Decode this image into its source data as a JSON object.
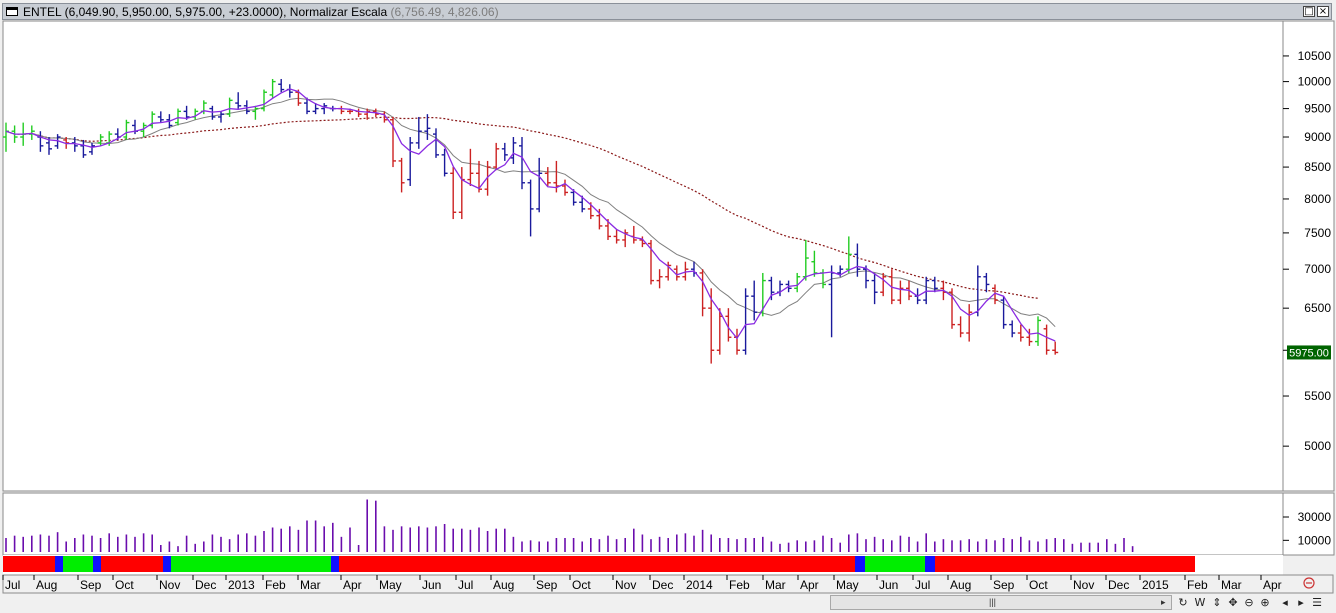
{
  "window": {
    "symbol": "ENTEL",
    "ohlc_text": "(6,049.90, 5,950.00, 5,975.00, +23.0000),",
    "scale_label": "Normalizar Escala",
    "scale_values": "(6,756.49, 4,826.06)",
    "restore_glyph": "□",
    "close_glyph": "×"
  },
  "price_label": "5975.00",
  "chart_data": [
    {
      "type": "ohlc",
      "y_ticks": [
        "10500",
        "10000",
        "9500",
        "9000",
        "8500",
        "8000",
        "7500",
        "7000",
        "6500",
        "6000",
        "5500",
        "5000"
      ],
      "y_tick_values": [
        10500,
        10000,
        9500,
        9000,
        8500,
        8000,
        7500,
        7000,
        6500,
        6000,
        5500,
        5000
      ],
      "ylim": [
        4600,
        11200
      ],
      "scale": "log",
      "last_close": 5975.0,
      "bar_colors": {
        "up": "#22cc22",
        "down": "#cc2222",
        "neutral": "#1a1a9c"
      },
      "series": [
        {
          "name": "",
          "kind": "moving-average-fast",
          "color": "#8a2be2"
        },
        {
          "name": "",
          "kind": "moving-average-slow",
          "color": "#808080"
        },
        {
          "name": "",
          "kind": "moving-average-long-dotted",
          "color": "#8b1a1a"
        }
      ],
      "bars": [
        [
          9000,
          9250,
          8750,
          9100,
          "g"
        ],
        [
          9100,
          9200,
          8900,
          9000,
          "g"
        ],
        [
          9000,
          9250,
          8850,
          9050,
          "g"
        ],
        [
          9050,
          9200,
          8950,
          9100,
          "g"
        ],
        [
          9000,
          9100,
          8750,
          8850,
          "b"
        ],
        [
          8900,
          9000,
          8700,
          8800,
          "b"
        ],
        [
          8850,
          9050,
          8800,
          9000,
          "b"
        ],
        [
          8950,
          9000,
          8800,
          8900,
          "r"
        ],
        [
          8900,
          9000,
          8750,
          8850,
          "b"
        ],
        [
          8850,
          8950,
          8650,
          8700,
          "b"
        ],
        [
          8750,
          8900,
          8700,
          8850,
          "b"
        ],
        [
          8900,
          9050,
          8850,
          9000,
          "g"
        ],
        [
          8900,
          9100,
          8850,
          9050,
          "g"
        ],
        [
          9050,
          9150,
          8950,
          9000,
          "b"
        ],
        [
          9000,
          9300,
          8950,
          9250,
          "g"
        ],
        [
          9200,
          9300,
          9050,
          9100,
          "b"
        ],
        [
          9100,
          9250,
          9000,
          9200,
          "g"
        ],
        [
          9200,
          9450,
          9150,
          9400,
          "g"
        ],
        [
          9350,
          9450,
          9250,
          9300,
          "b"
        ],
        [
          9300,
          9400,
          9150,
          9200,
          "b"
        ],
        [
          9250,
          9500,
          9200,
          9450,
          "g"
        ],
        [
          9450,
          9550,
          9300,
          9350,
          "b"
        ],
        [
          9350,
          9500,
          9300,
          9450,
          "g"
        ],
        [
          9450,
          9650,
          9400,
          9600,
          "g"
        ],
        [
          9500,
          9550,
          9300,
          9350,
          "b"
        ],
        [
          9350,
          9450,
          9250,
          9400,
          "b"
        ],
        [
          9400,
          9700,
          9350,
          9650,
          "g"
        ],
        [
          9600,
          9800,
          9500,
          9550,
          "b"
        ],
        [
          9550,
          9650,
          9400,
          9450,
          "b"
        ],
        [
          9450,
          9550,
          9300,
          9500,
          "g"
        ],
        [
          9500,
          9850,
          9450,
          9800,
          "g"
        ],
        [
          9750,
          10050,
          9700,
          10000,
          "g"
        ],
        [
          9950,
          10050,
          9800,
          9850,
          "b"
        ],
        [
          9850,
          9950,
          9700,
          9800,
          "b"
        ],
        [
          9800,
          9850,
          9550,
          9600,
          "r"
        ],
        [
          9600,
          9700,
          9400,
          9450,
          "b"
        ],
        [
          9450,
          9600,
          9400,
          9500,
          "b"
        ],
        [
          9500,
          9600,
          9400,
          9550,
          "b"
        ],
        [
          9500,
          9550,
          9450,
          9500,
          "b"
        ],
        [
          9500,
          9550,
          9400,
          9450,
          "r"
        ],
        [
          9450,
          9500,
          9400,
          9450,
          "r"
        ],
        [
          9450,
          9500,
          9350,
          9400,
          "r"
        ],
        [
          9400,
          9500,
          9300,
          9450,
          "r"
        ],
        [
          9450,
          9500,
          9350,
          9400,
          "r"
        ],
        [
          9400,
          9450,
          9250,
          9300,
          "r"
        ],
        [
          9300,
          9350,
          8500,
          8600,
          "r"
        ],
        [
          8600,
          8650,
          8100,
          8250,
          "r"
        ],
        [
          8300,
          9000,
          8200,
          8900,
          "b"
        ],
        [
          8900,
          9350,
          8800,
          9100,
          "b"
        ],
        [
          9100,
          9400,
          8950,
          9150,
          "b"
        ],
        [
          9050,
          9150,
          8650,
          8700,
          "b"
        ],
        [
          8700,
          8800,
          8350,
          8400,
          "b"
        ],
        [
          8400,
          8500,
          7700,
          7800,
          "r"
        ],
        [
          7800,
          8500,
          7700,
          8300,
          "r"
        ],
        [
          8300,
          8800,
          8200,
          8400,
          "r"
        ],
        [
          8400,
          8600,
          8100,
          8150,
          "r"
        ],
        [
          8150,
          8600,
          8050,
          8500,
          "r"
        ],
        [
          8500,
          8900,
          8450,
          8800,
          "r"
        ],
        [
          8800,
          8900,
          8600,
          8700,
          "b"
        ],
        [
          8650,
          9000,
          8550,
          8900,
          "b"
        ],
        [
          8850,
          9000,
          8150,
          8250,
          "b"
        ],
        [
          8250,
          8300,
          7450,
          7850,
          "b"
        ],
        [
          7850,
          8650,
          7800,
          8400,
          "b"
        ],
        [
          8400,
          8500,
          8200,
          8250,
          "r"
        ],
        [
          8250,
          8600,
          8100,
          8200,
          "r"
        ],
        [
          8200,
          8300,
          8050,
          8100,
          "r"
        ],
        [
          8100,
          8150,
          7900,
          7950,
          "b"
        ],
        [
          7950,
          8050,
          7800,
          7850,
          "b"
        ],
        [
          7850,
          7950,
          7700,
          7750,
          "r"
        ],
        [
          7750,
          7850,
          7550,
          7600,
          "r"
        ],
        [
          7600,
          7700,
          7400,
          7450,
          "r"
        ],
        [
          7450,
          7550,
          7350,
          7400,
          "r"
        ],
        [
          7400,
          7550,
          7300,
          7500,
          "r"
        ],
        [
          7450,
          7600,
          7350,
          7400,
          "r"
        ],
        [
          7400,
          7450,
          7300,
          7350,
          "r"
        ],
        [
          7350,
          7400,
          6800,
          6850,
          "r"
        ],
        [
          6850,
          7000,
          6750,
          6900,
          "r"
        ],
        [
          6900,
          7100,
          6850,
          7050,
          "r"
        ],
        [
          7000,
          7050,
          6850,
          6900,
          "r"
        ],
        [
          6900,
          7100,
          6850,
          7000,
          "r"
        ],
        [
          7000,
          7100,
          6900,
          6950,
          "b"
        ],
        [
          6950,
          7000,
          6400,
          6500,
          "r"
        ],
        [
          6500,
          6750,
          5850,
          6000,
          "r"
        ],
        [
          6000,
          6500,
          5950,
          6400,
          "r"
        ],
        [
          6400,
          6500,
          6100,
          6150,
          "r"
        ],
        [
          6150,
          6250,
          5950,
          6000,
          "r"
        ],
        [
          6000,
          6750,
          5950,
          6650,
          "b"
        ],
        [
          6650,
          6850,
          6350,
          6450,
          "b"
        ],
        [
          6450,
          6950,
          6400,
          6850,
          "g"
        ],
        [
          6850,
          6900,
          6600,
          6700,
          "b"
        ],
        [
          6700,
          6850,
          6650,
          6800,
          "b"
        ],
        [
          6800,
          6850,
          6700,
          6750,
          "b"
        ],
        [
          6750,
          6950,
          6700,
          6900,
          "g"
        ],
        [
          6900,
          7400,
          6850,
          7150,
          "g"
        ],
        [
          7100,
          7250,
          6900,
          6950,
          "g"
        ],
        [
          6950,
          7000,
          6750,
          6800,
          "g"
        ],
        [
          6800,
          7050,
          6150,
          6950,
          "b"
        ],
        [
          6950,
          7050,
          6900,
          7000,
          "b"
        ],
        [
          7000,
          7450,
          6950,
          7200,
          "g"
        ],
        [
          7200,
          7350,
          6900,
          7000,
          "b"
        ],
        [
          7000,
          7050,
          6750,
          6850,
          "b"
        ],
        [
          6850,
          6950,
          6550,
          6700,
          "b"
        ],
        [
          6700,
          6950,
          6650,
          6900,
          "r"
        ],
        [
          6900,
          7000,
          6550,
          6600,
          "r"
        ],
        [
          6600,
          6850,
          6550,
          6750,
          "r"
        ],
        [
          6750,
          6850,
          6600,
          6650,
          "r"
        ],
        [
          6650,
          6750,
          6550,
          6600,
          "b"
        ],
        [
          6600,
          6900,
          6550,
          6850,
          "b"
        ],
        [
          6850,
          6900,
          6700,
          6750,
          "b"
        ],
        [
          6750,
          6850,
          6600,
          6700,
          "r"
        ],
        [
          6700,
          6750,
          6250,
          6300,
          "r"
        ],
        [
          6300,
          6400,
          6150,
          6200,
          "r"
        ],
        [
          6200,
          6550,
          6100,
          6450,
          "r"
        ],
        [
          6450,
          7050,
          6400,
          6900,
          "b"
        ],
        [
          6900,
          6950,
          6700,
          6800,
          "b"
        ],
        [
          6750,
          6800,
          6550,
          6600,
          "r"
        ],
        [
          6600,
          6650,
          6250,
          6300,
          "b"
        ],
        [
          6300,
          6350,
          6150,
          6200,
          "b"
        ],
        [
          6200,
          6300,
          6100,
          6150,
          "r"
        ],
        [
          6150,
          6250,
          6050,
          6100,
          "r"
        ],
        [
          6100,
          6400,
          6050,
          6350,
          "g"
        ],
        [
          6250,
          6300,
          5950,
          6000,
          "r"
        ],
        [
          6000,
          6100,
          5950,
          5975,
          "r"
        ]
      ]
    },
    {
      "type": "bar",
      "kind": "volume",
      "y_ticks": [
        "30000",
        "10000"
      ],
      "y_tick_values": [
        30000,
        10000
      ],
      "ylim": [
        0,
        48000
      ],
      "color": "#6a0dad",
      "values": [
        12000,
        14000,
        13000,
        14000,
        15000,
        14000,
        17000,
        9000,
        12000,
        15000,
        14000,
        12000,
        16000,
        13000,
        15000,
        13000,
        16000,
        15000,
        6000,
        9000,
        5000,
        14000,
        7000,
        9000,
        15000,
        13000,
        11000,
        15000,
        16000,
        14000,
        18000,
        21000,
        20000,
        22000,
        19000,
        27000,
        27000,
        22000,
        25000,
        13000,
        21000,
        6000,
        45000,
        44000,
        22000,
        19000,
        22000,
        21000,
        22000,
        21000,
        22000,
        24000,
        20000,
        20000,
        19000,
        21000,
        18000,
        20000,
        20000,
        13000,
        9000,
        10000,
        9000,
        9000,
        12000,
        12000,
        12000,
        9000,
        12000,
        11000,
        14000,
        11000,
        12000,
        20000,
        15000,
        11000,
        13000,
        12000,
        15000,
        16000,
        14000,
        19000,
        15000,
        12000,
        12000,
        11000,
        12000,
        12000,
        13000,
        9000,
        7000,
        8000,
        10000,
        9000,
        10000,
        14000,
        12000,
        8000,
        15000,
        16000,
        11000,
        13000,
        11000,
        10000,
        14000,
        13000,
        9000,
        16000,
        9000,
        11000,
        10000,
        10000,
        11000,
        9000,
        11000,
        10000,
        12000,
        11000,
        13000,
        10000,
        9000,
        11000,
        12000,
        11000,
        7000,
        8000,
        8000,
        8000,
        11000,
        7000,
        12000,
        5000
      ]
    }
  ],
  "trend_strip": {
    "segments": [
      [
        "r",
        0,
        52
      ],
      [
        "b",
        52,
        8
      ],
      [
        "g",
        60,
        30
      ],
      [
        "b",
        90,
        8
      ],
      [
        "r",
        98,
        62
      ],
      [
        "b",
        160,
        8
      ],
      [
        "g",
        168,
        160
      ],
      [
        "b",
        328,
        8
      ],
      [
        "r",
        336,
        516
      ],
      [
        "b",
        852,
        10
      ],
      [
        "g",
        862,
        60
      ],
      [
        "b",
        922,
        10
      ],
      [
        "r",
        932,
        260
      ]
    ]
  },
  "x_axis": {
    "labels": [
      [
        "Jul",
        3
      ],
      [
        "Aug",
        34
      ],
      [
        "Sep",
        78
      ],
      [
        "Oct",
        113
      ],
      [
        "Nov",
        157
      ],
      [
        "Dec",
        193
      ],
      [
        "2013",
        226
      ],
      [
        "Feb",
        263
      ],
      [
        "Mar",
        298
      ],
      [
        "Apr",
        341
      ],
      [
        "May",
        377
      ],
      [
        "Jun",
        420
      ],
      [
        "Jul",
        456
      ],
      [
        "Aug",
        491
      ],
      [
        "Sep",
        534
      ],
      [
        "Oct",
        570
      ],
      [
        "Nov",
        613
      ],
      [
        "Dec",
        650
      ],
      [
        "2014",
        684
      ],
      [
        "Feb",
        727
      ],
      [
        "Mar",
        763
      ],
      [
        "Apr",
        798
      ],
      [
        "May",
        834
      ],
      [
        "Jun",
        877
      ],
      [
        "Jul",
        913
      ],
      [
        "Aug",
        948
      ],
      [
        "Sep",
        991
      ],
      [
        "Oct",
        1027
      ],
      [
        "Nov",
        1071
      ],
      [
        "Dec",
        1106
      ],
      [
        "2015",
        1140
      ],
      [
        "Feb",
        1185
      ],
      [
        "Mar",
        1219
      ],
      [
        "Apr",
        1261
      ]
    ]
  },
  "toolbar": {
    "scroll_grip": "|||",
    "scroll_arrow": "▸",
    "tools": [
      "↻",
      "W",
      "⇕",
      "✥",
      "⊖",
      "⊕",
      "◂",
      "▸",
      "☰"
    ]
  }
}
